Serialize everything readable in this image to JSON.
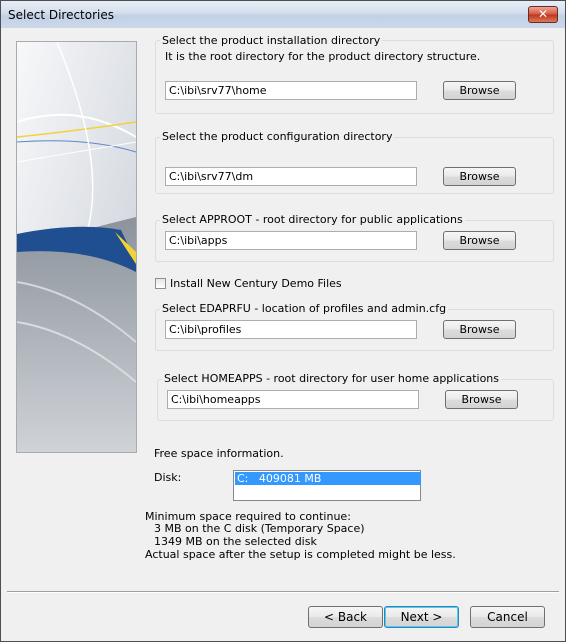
{
  "window": {
    "title": "Select Directories",
    "close_glyph": "✕"
  },
  "install_dir": {
    "label": "Select the product installation directory",
    "description": "It is the root directory for the product directory structure.",
    "value": "C:\\ibi\\srv77\\home",
    "browse": "Browse"
  },
  "config_dir": {
    "label": "Select the product configuration directory",
    "value": "C:\\ibi\\srv77\\dm",
    "browse": "Browse"
  },
  "approot": {
    "label": "Select APPROOT - root directory for public applications",
    "value": "C:\\ibi\\apps",
    "browse": "Browse"
  },
  "demo_files": {
    "label": "Install New Century Demo Files",
    "checked": false
  },
  "edaprfu": {
    "label": "Select EDAPRFU - location of profiles and admin.cfg",
    "value": "C:\\ibi\\profiles",
    "browse": "Browse"
  },
  "homeapps": {
    "label": "Select HOMEAPPS - root directory for user home applications",
    "value": "C:\\ibi\\homeapps",
    "browse": "Browse"
  },
  "free_space": {
    "title": "Free space information.",
    "disk_label": "Disk:",
    "disk_entry": "C:   409081 MB"
  },
  "requirements": {
    "line1": "Minimum space required to continue:",
    "line2": "3 MB on the C disk (Temporary Space)",
    "line3": "1349 MB on the selected disk",
    "line4": "Actual space after the setup is completed might be less."
  },
  "nav": {
    "back": "< Back",
    "next": "Next >",
    "cancel": "Cancel"
  }
}
